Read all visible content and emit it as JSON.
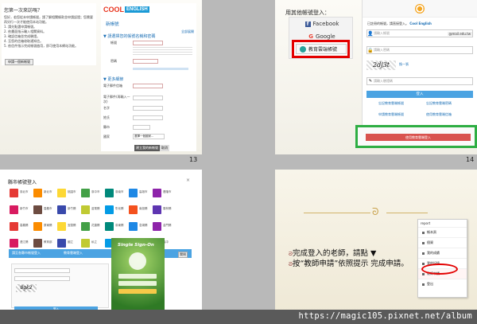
{
  "slides": {
    "s13": {
      "page_number": "13",
      "intro_title": "您第一次來訪嗎？",
      "intro_lines": [
        "您好，若您從未申請帳號，請了解相關條款並申請認證；您需要再另行一次才能使用本站功能。",
        "1. 請先點選申請帳號。",
        "2. 依畫面指示輸入相關資料。",
        "3. 確認信箱並完成驗證。",
        "4. 至您的信箱收取通知信。",
        "5. 依信件指示完成帳號啟用，即可使用本網站功能。"
      ],
      "intro_button": "申請一個新帳號",
      "logo_cool": "COOL",
      "logo_english": "ENGLISH",
      "form_title": "新帳號",
      "expand_label": "全部展開",
      "section1": "▼ 請選擇您的帳號名稱和密碼",
      "section2": "▼ 更多細節",
      "label_account": "帳號",
      "label_password": "密碼",
      "label_email": "電子郵件信箱",
      "label_email2": "電子郵件(再輸入一次)",
      "label_name": "名字",
      "label_surname": "姓氏",
      "label_city": "縣市",
      "label_country": "國家",
      "country_value": "選擇一個國家...",
      "btn_create": "建立我的新帳號",
      "btn_cancel": "取消"
    },
    "s14": {
      "page_number": "14",
      "other_login_title": "用其他帳號登入：",
      "facebook": "Facebook",
      "google": "Google",
      "edu_cloud": "教育雲端帳號",
      "login_hint": "已註冊的帳號，請直接登入。",
      "login_brand": "Cool English",
      "account_placeholder": "請輸入帳號",
      "domain_suffix": "@mail.edu.tw",
      "password_placeholder": "請輸入密碼",
      "captcha_text": "2dj3t",
      "captcha_refresh": "換一張",
      "captcha_placeholder": "請輸入驗證碼",
      "login_button": "登入",
      "link_forgot_id": "忘記教育雲端帳號",
      "link_forgot_pw": "忘記教育雲端密碼",
      "link_apply": "申請教育雲端帳號",
      "link_apply_email": "使用教育雲端信箱",
      "teacher_apply_button": "使用教育雲端登入"
    },
    "s15": {
      "dialog_title": "縣市帳號登入",
      "cities": [
        "臺北市",
        "新北市",
        "桃園市",
        "臺中市",
        "臺南市",
        "高雄市",
        "基隆市",
        "新竹市",
        "嘉義市",
        "新竹縣",
        "苗栗縣",
        "彰化縣",
        "南投縣",
        "雲林縣",
        "嘉義縣",
        "屏東縣",
        "宜蘭縣",
        "花蓮縣",
        "臺東縣",
        "澎湖縣",
        "金門縣",
        "連江縣",
        "教育部",
        "國立",
        "私立",
        "其他",
        "大專",
        "高中"
      ],
      "login_bar_left": "請至各縣市帳號登入",
      "login_bar_right": "教育雲端登入",
      "close_button": "關閉",
      "single_signon": "Single Sign-On",
      "captcha_text": "8gk2",
      "login_button": "登入"
    },
    "s16": {
      "divider_symbol": "ᘐ",
      "line1": "完成登入的老師，請點 ▼",
      "line2": "按“教師申請”依照提示 完成申請。",
      "menu_top": "report",
      "menu_items": [
        "帳本頁",
        "個資",
        "我的成績",
        "我的記錄",
        "教師申請",
        "登出"
      ],
      "menu_highlight_index": 4
    }
  },
  "footer": {
    "url": "https://magic105.pixnet.net/album"
  },
  "colors": {
    "cool_blue": "#1b9ad6",
    "red_highlight": "#e30000",
    "green_highlight": "#2eae43",
    "login_blue": "#4ba3e2",
    "facebook_blue": "#3b5998",
    "footer_bg": "#5a5a5a"
  }
}
